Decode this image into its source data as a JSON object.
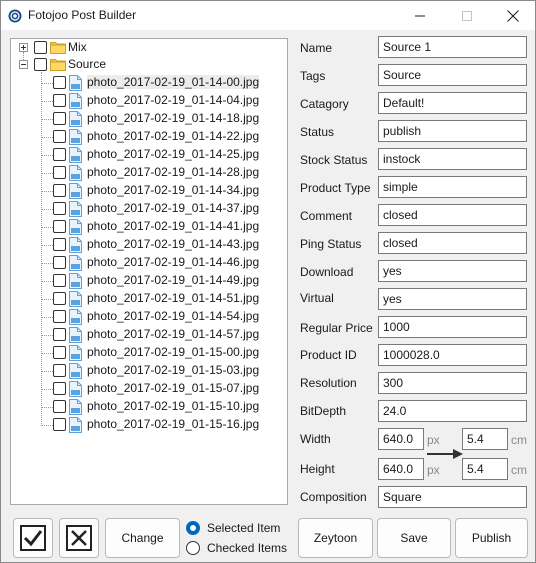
{
  "window": {
    "title": "Fotojoo Post Builder"
  },
  "tree": {
    "root_nodes": [
      {
        "label": "Mix",
        "expanded": false
      },
      {
        "label": "Source",
        "expanded": true
      }
    ],
    "files": [
      "photo_2017-02-19_01-14-00.jpg",
      "photo_2017-02-19_01-14-04.jpg",
      "photo_2017-02-19_01-14-18.jpg",
      "photo_2017-02-19_01-14-22.jpg",
      "photo_2017-02-19_01-14-25.jpg",
      "photo_2017-02-19_01-14-28.jpg",
      "photo_2017-02-19_01-14-34.jpg",
      "photo_2017-02-19_01-14-37.jpg",
      "photo_2017-02-19_01-14-41.jpg",
      "photo_2017-02-19_01-14-43.jpg",
      "photo_2017-02-19_01-14-46.jpg",
      "photo_2017-02-19_01-14-49.jpg",
      "photo_2017-02-19_01-14-51.jpg",
      "photo_2017-02-19_01-14-54.jpg",
      "photo_2017-02-19_01-14-57.jpg",
      "photo_2017-02-19_01-15-00.jpg",
      "photo_2017-02-19_01-15-03.jpg",
      "photo_2017-02-19_01-15-07.jpg",
      "photo_2017-02-19_01-15-10.jpg",
      "photo_2017-02-19_01-15-16.jpg"
    ]
  },
  "fields": {
    "name": {
      "label": "Name",
      "value": "Source 1"
    },
    "tags": {
      "label": "Tags",
      "value": "Source"
    },
    "category": {
      "label": "Catagory",
      "value": "Default!"
    },
    "status": {
      "label": "Status",
      "value": "publish"
    },
    "stock_status": {
      "label": "Stock Status",
      "value": "instock"
    },
    "product_type": {
      "label": "Product Type",
      "value": "simple"
    },
    "comment": {
      "label": "Comment",
      "value": "closed"
    },
    "ping_status": {
      "label": "Ping Status",
      "value": "closed"
    },
    "download": {
      "label": "Download",
      "value": "yes"
    },
    "virtual": {
      "label": "Virtual",
      "value": "yes"
    },
    "regular_price": {
      "label": "Regular Price",
      "value": "1000"
    },
    "product_id": {
      "label": "Product ID",
      "value": "1000028.0"
    },
    "resolution": {
      "label": "Resolution",
      "value": "300"
    },
    "bitdepth": {
      "label": "BitDepth",
      "value": "24.0"
    },
    "width": {
      "label": "Width",
      "px_value": "640.0",
      "px_unit": "px",
      "cm_value": "5.4",
      "cm_unit": "cm"
    },
    "height": {
      "label": "Height",
      "px_value": "640.0",
      "px_unit": "px",
      "cm_value": "5.4",
      "cm_unit": "cm"
    },
    "composition": {
      "label": "Composition",
      "value": "Square"
    }
  },
  "bottom": {
    "change_label": "Change",
    "radio_selected_label": "Selected Item",
    "radio_checked_label": "Checked Items",
    "selected_option": "Selected Item",
    "zeytoon_label": "Zeytoon",
    "save_label": "Save",
    "publish_label": "Publish"
  },
  "colors": {
    "accent": "#0067c0",
    "folder": "#f4c542",
    "file": "#5aa2e0"
  }
}
